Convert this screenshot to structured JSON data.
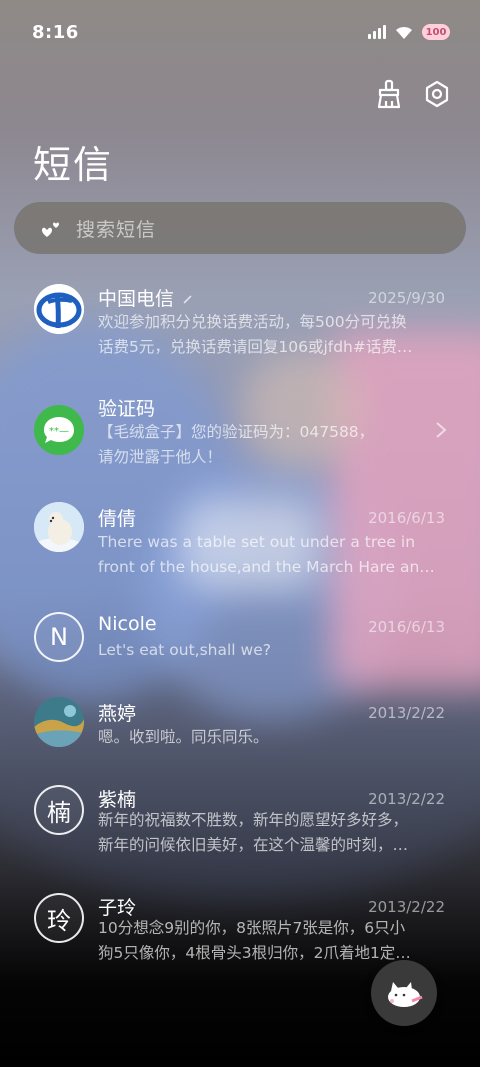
{
  "status_bar": {
    "time": "8:16",
    "battery": "100"
  },
  "header": {
    "title": "短信"
  },
  "search": {
    "placeholder": "搜索短信"
  },
  "conversations": [
    {
      "name": "中国电信",
      "date": "2025/9/30",
      "preview": [
        "欢迎参加积分兑换话费活动，每500分可兑换",
        "话费5元，兑换话费请回复106或jfdh#话费…"
      ],
      "avatar_icon": "china-telecom-logo"
    },
    {
      "name": "验证码",
      "date": "",
      "preview": [
        "【毛绒盒子】您的验证码为：047588，",
        "请勿泄露于他人！"
      ],
      "avatar_icon": "verification-code-icon"
    },
    {
      "name": "倩倩",
      "date": "2016/6/13",
      "preview": [
        "There was a table set out under a tree in",
        "front of the house,and the March Hare an…"
      ],
      "avatar_icon": "polar-bear-photo"
    },
    {
      "name": "Nicole",
      "date": "2016/6/13",
      "preview": [
        "Let's eat out,shall we?"
      ],
      "avatar_letter": "N"
    },
    {
      "name": "燕婷",
      "date": "2013/2/22",
      "preview": [
        "嗯。收到啦。同乐同乐。"
      ],
      "avatar_icon": "landscape-photo"
    },
    {
      "name": "紫楠",
      "date": "2013/2/22",
      "preview": [
        "新年的祝福数不胜数，新年的愿望好多好多，",
        "新年的问候依旧美好，在这个温馨的时刻，…"
      ],
      "avatar_letter": "楠"
    },
    {
      "name": "子玲",
      "date": "2013/2/22",
      "preview": [
        "10分想念9别的你，8张照片7张是你，6只小",
        "狗5只像你，4根骨头3根归你，2爪着地1定…"
      ],
      "avatar_letter": "玲"
    }
  ],
  "colors": {
    "telecom_blue": "#1e5fbf",
    "verification_green": "#3fb94c"
  }
}
